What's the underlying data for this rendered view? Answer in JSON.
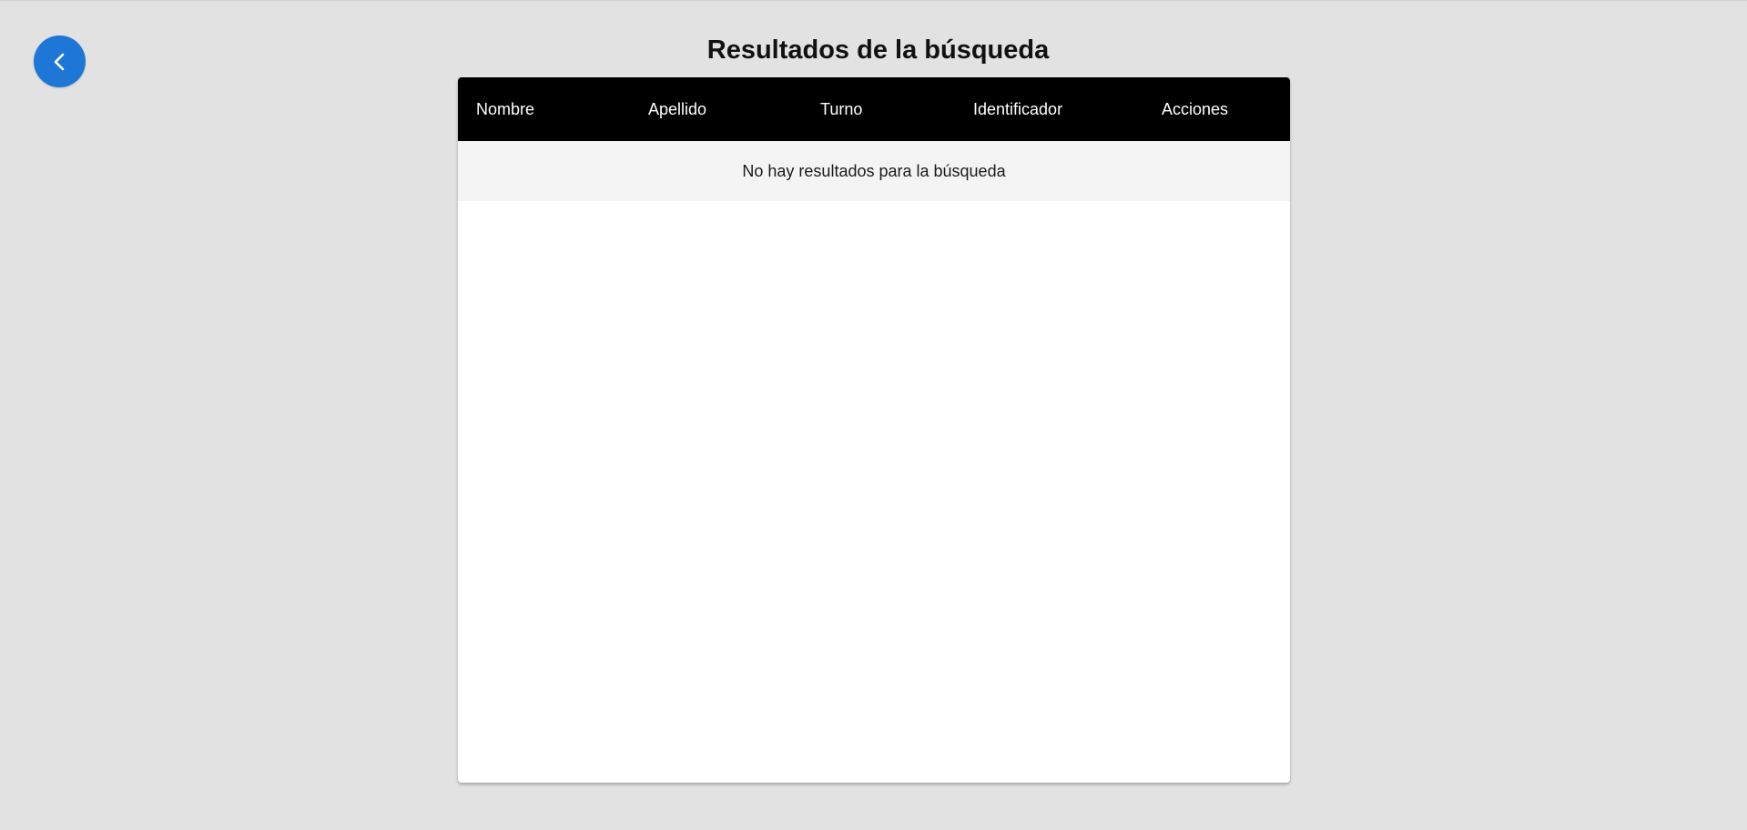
{
  "header": {
    "title": "Resultados de la búsqueda"
  },
  "back_button": {
    "icon": "chevron-left-icon",
    "color": "#1e76d6"
  },
  "table": {
    "columns": [
      "Nombre",
      "Apellido",
      "Turno",
      "Identificador",
      "Acciones"
    ],
    "empty_message": "No hay resultados para la búsqueda",
    "header_color": "#000000"
  }
}
